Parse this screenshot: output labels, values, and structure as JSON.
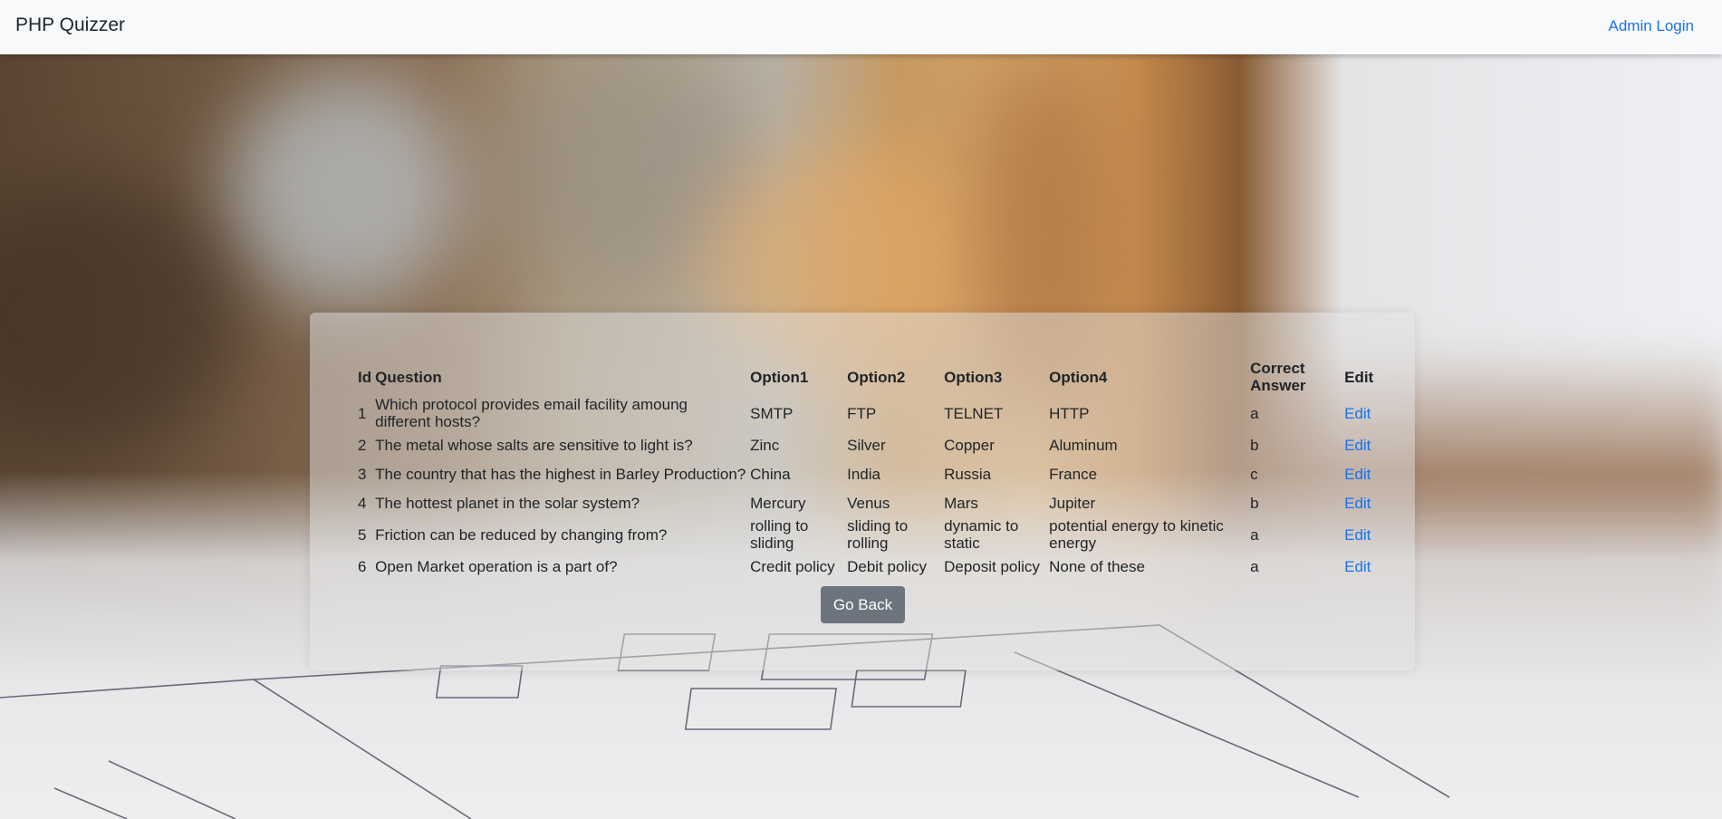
{
  "navbar": {
    "brand": "PHP Quizzer",
    "admin_login": "Admin Login"
  },
  "table": {
    "headers": [
      "Id",
      "Question",
      "Option1",
      "Option2",
      "Option3",
      "Option4",
      "Correct Answer",
      "Edit"
    ],
    "rows": [
      {
        "id": "1",
        "question": "Which protocol provides email facility amoung different hosts?",
        "option1": "SMTP",
        "option2": "FTP",
        "option3": "TELNET",
        "option4": "HTTP",
        "answer": "a",
        "edit": "Edit"
      },
      {
        "id": "2",
        "question": "The metal whose salts are sensitive to light is?",
        "option1": "Zinc",
        "option2": "Silver",
        "option3": "Copper",
        "option4": "Aluminum",
        "answer": "b",
        "edit": "Edit"
      },
      {
        "id": "3",
        "question": "The country that has the highest in Barley Production?",
        "option1": "China",
        "option2": "India",
        "option3": "Russia",
        "option4": "France",
        "answer": "c",
        "edit": "Edit"
      },
      {
        "id": "4",
        "question": "The hottest planet in the solar system?",
        "option1": "Mercury",
        "option2": "Venus",
        "option3": "Mars",
        "option4": "Jupiter",
        "answer": "b",
        "edit": "Edit"
      },
      {
        "id": "5",
        "question": "Friction can be reduced by changing from?",
        "option1": "rolling to sliding",
        "option2": "sliding to rolling",
        "option3": "dynamic to static",
        "option4": "potential energy to kinetic energy",
        "answer": "a",
        "edit": "Edit"
      },
      {
        "id": "6",
        "question": "Open Market operation is a part of?",
        "option1": "Credit policy",
        "option2": "Debit policy",
        "option3": "Deposit policy",
        "option4": "None of these",
        "answer": "a",
        "edit": "Edit"
      }
    ]
  },
  "go_back_label": "Go Back",
  "colors": {
    "link": "#1a73e8",
    "button": "#6c757d",
    "navbar": "#f8f9fa"
  }
}
